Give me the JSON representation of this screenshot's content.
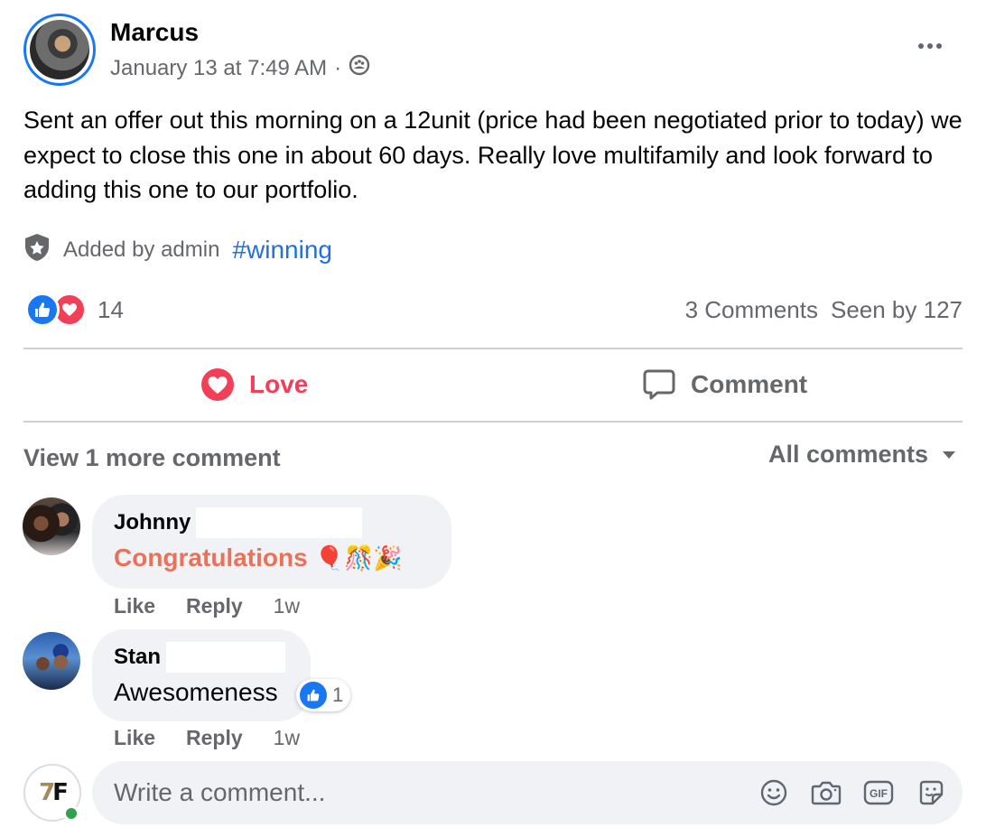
{
  "post": {
    "author": "Marcus",
    "timestamp": "January 13 at 7:49 AM",
    "separator": "·",
    "audience_icon": "group-audience-icon",
    "body": "Sent an offer out this morning on a 12unit (price had been negotiated prior to today) we expect to close this one in  about 60 days.  Really love multifamily and look forward to adding this one to our portfolio.",
    "admin_badge_icon": "shield-star-icon",
    "admin_label": "Added by admin",
    "hashtag": "#winning",
    "reaction_count": "14",
    "comments_count": "3 Comments",
    "seen_by": "Seen by 127"
  },
  "actions": {
    "love_label": "Love",
    "comment_label": "Comment"
  },
  "comments_section": {
    "view_more": "View 1 more comment",
    "filter": "All comments",
    "comments": [
      {
        "name": "Johnny",
        "text": "Congratulations",
        "emojis": "🎈🎊🎉",
        "like": "Like",
        "reply": "Reply",
        "time": "1w"
      },
      {
        "name": "Stan",
        "text": "Awesomeness",
        "reaction_count": "1",
        "like": "Like",
        "reply": "Reply",
        "time": "1w"
      }
    ]
  },
  "composer": {
    "placeholder": "Write a comment...",
    "avatar_logo": "7F",
    "tools": [
      "emoji-icon",
      "camera-icon",
      "gif-icon",
      "sticker-icon"
    ]
  },
  "colors": {
    "accent": "#1877f2",
    "love": "#f33e58",
    "hashtag": "#216fdb",
    "congrats": "#e8735a",
    "secondary_text": "#65676b",
    "bubble_bg": "#f0f2f5"
  }
}
